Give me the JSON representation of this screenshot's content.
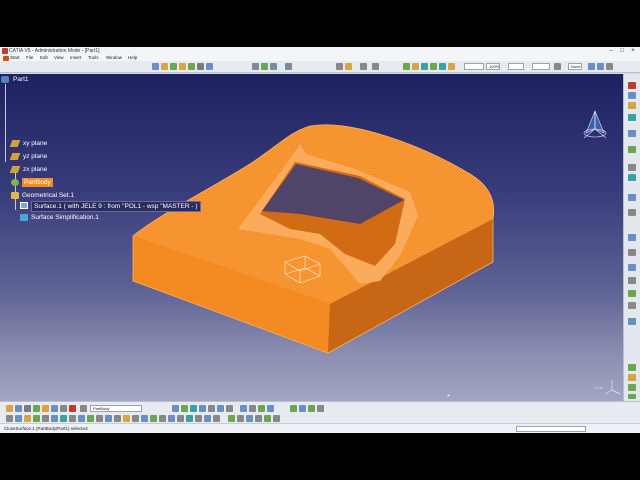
{
  "window": {
    "title": "CATIA V5 - Administration Mode - [Part1]",
    "controls": [
      "–",
      "□",
      "×"
    ]
  },
  "menu": {
    "items": [
      "Start",
      "File",
      "Edit",
      "View",
      "Insert",
      "Tools",
      "Window",
      "Help"
    ]
  },
  "toolbar_top": {
    "zoom_value": "100%",
    "render_style": "None"
  },
  "tree": {
    "root": "Part1",
    "planes": [
      "xy plane",
      "yz plane",
      "zx plane"
    ],
    "body": "PartBody",
    "geometrical_set": "Geometrical Set.1",
    "surface1": "Surface.1  (  with JELE 9 : from \"POL1 - wsp \"MASTER -  )",
    "surface_simplification": "Surface Simplification.1"
  },
  "toolbar_bottom": {
    "current_body": "PartBody"
  },
  "viewport": {
    "scale_label": "1:03",
    "part_color": "#f58a1e"
  },
  "status": {
    "text": "CloseSurface.1 (PartBody/Part1) selected"
  },
  "icons": [
    "catia-app-icon",
    "compass-icon",
    "axis-triad-icon"
  ],
  "colors": {
    "accent": "#f58a1e",
    "viewport_top": "#1e2160",
    "viewport_bottom": "#a3a6c2"
  }
}
